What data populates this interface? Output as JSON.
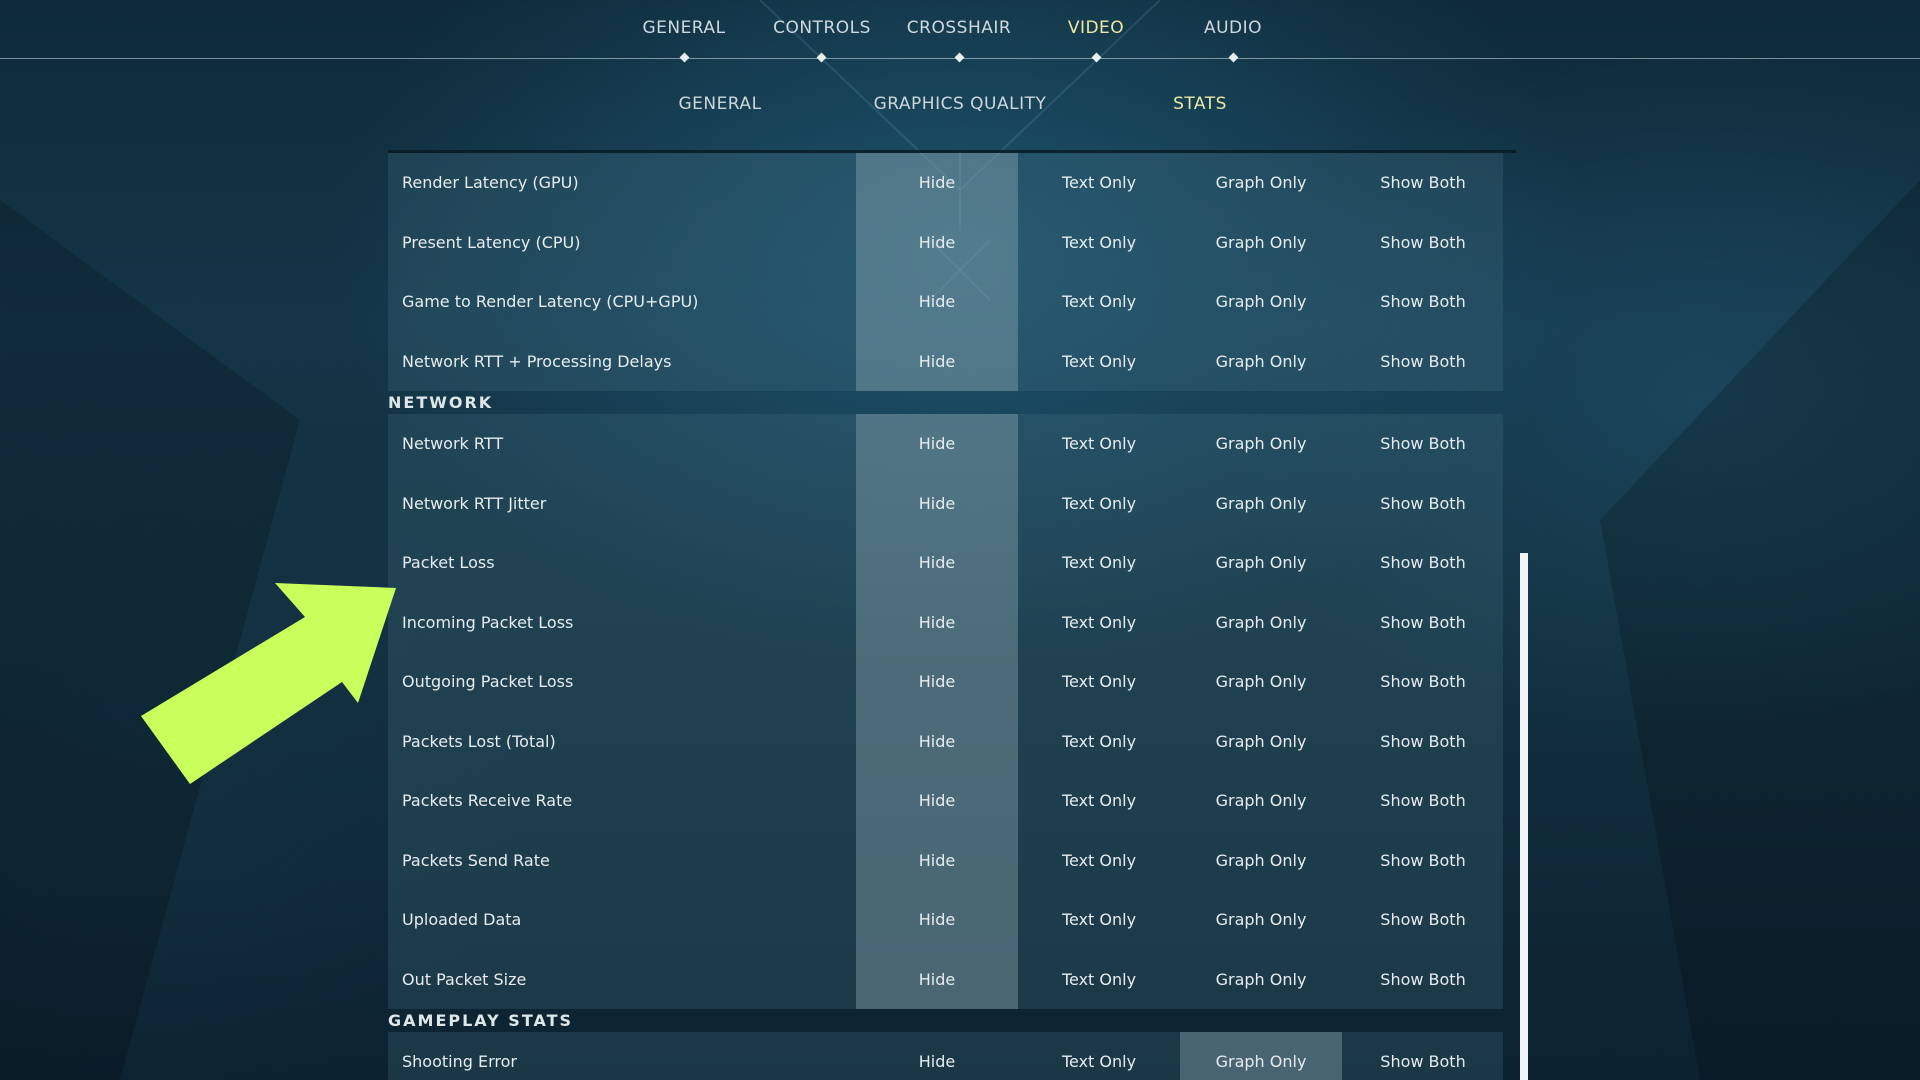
{
  "top_tabs": [
    {
      "label": "GENERAL"
    },
    {
      "label": "CONTROLS"
    },
    {
      "label": "CROSSHAIR"
    },
    {
      "label": "VIDEO"
    },
    {
      "label": "AUDIO"
    }
  ],
  "active_top_tab": "VIDEO",
  "sub_tabs": [
    {
      "label": "GENERAL"
    },
    {
      "label": "GRAPHICS QUALITY"
    },
    {
      "label": "STATS"
    }
  ],
  "active_sub_tab": "STATS",
  "options": [
    "Hide",
    "Text Only",
    "Graph Only",
    "Show Both"
  ],
  "latency_rows": [
    {
      "label": "Render Latency (GPU)",
      "selected": "Hide"
    },
    {
      "label": "Present Latency (CPU)",
      "selected": "Hide"
    },
    {
      "label": "Game to Render Latency (CPU+GPU)",
      "selected": "Hide"
    },
    {
      "label": "Network RTT + Processing Delays",
      "selected": "Hide"
    }
  ],
  "network": {
    "header": "NETWORK",
    "rows": [
      {
        "label": "Network RTT",
        "selected": "Hide"
      },
      {
        "label": "Network RTT Jitter",
        "selected": "Hide"
      },
      {
        "label": "Packet Loss",
        "selected": "Hide"
      },
      {
        "label": "Incoming Packet Loss",
        "selected": "Hide"
      },
      {
        "label": "Outgoing Packet Loss",
        "selected": "Hide"
      },
      {
        "label": "Packets Lost (Total)",
        "selected": "Hide"
      },
      {
        "label": "Packets Receive Rate",
        "selected": "Hide"
      },
      {
        "label": "Packets Send Rate",
        "selected": "Hide"
      },
      {
        "label": "Uploaded Data",
        "selected": "Hide"
      },
      {
        "label": "Out Packet Size",
        "selected": "Hide"
      }
    ]
  },
  "gameplay": {
    "header": "GAMEPLAY STATS",
    "rows": [
      {
        "label": "Shooting Error",
        "selected": "Graph Only"
      }
    ]
  },
  "colors": {
    "active_tab": "#ece8a2",
    "arrow": "#c8ff5a",
    "selected_cell": "#a0b9c3"
  }
}
